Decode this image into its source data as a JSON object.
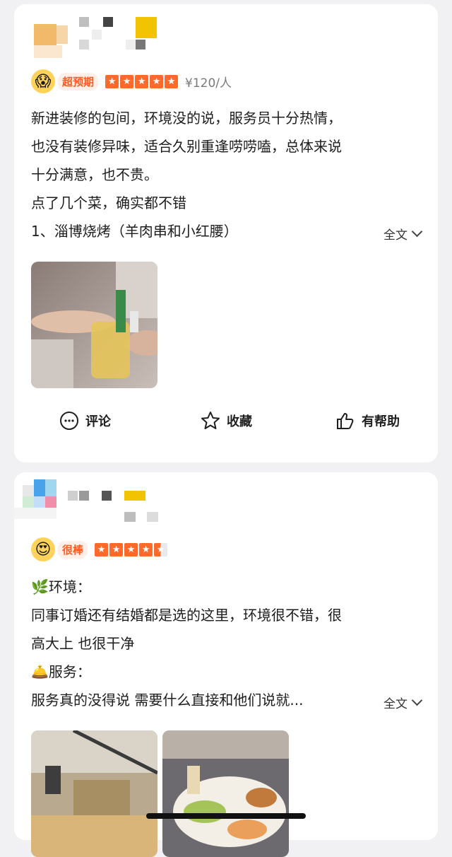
{
  "reviews": [
    {
      "rating_label": "超预期",
      "rating_emoji": "😱",
      "stars": 5,
      "price": "¥120/人",
      "lines": [
        "新进装修的包间，环境没的说，服务员十分热情，",
        "也没有装修异味，适合久别重逢唠唠嗑，总体来说",
        "十分满意，也不贵。",
        "点了几个菜，确实都不错",
        "1、淄博烧烤（羊肉串和小红腰）"
      ],
      "full_text_label": "全文",
      "actions": {
        "comment": "评论",
        "favorite": "收藏",
        "helpful": "有帮助"
      }
    },
    {
      "rating_label": "很棒",
      "rating_emoji": "😍",
      "stars": 4.5,
      "lines": [
        "🌿环境：",
        "同事订婚还有结婚都是选的这里，环境很不错，很",
        "高大上 也很干净",
        "🛎️服务：",
        "服务真的没得说 需要什么直接和他们说就..."
      ],
      "full_text_label": "全文"
    }
  ],
  "colors": {
    "accent": "#ff6a2b",
    "background": "#f1f1f3"
  }
}
